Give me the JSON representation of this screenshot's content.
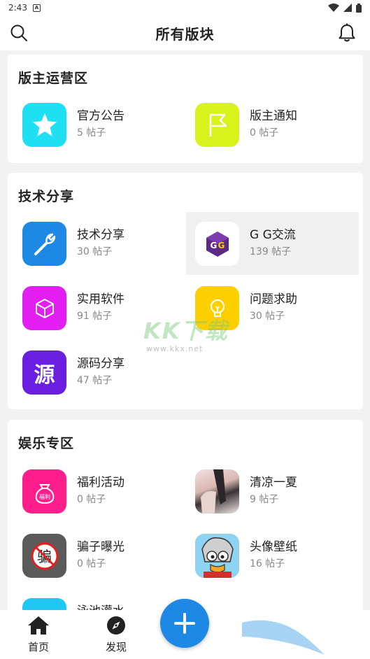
{
  "status": {
    "time": "2:43",
    "note_icon_letter": "A"
  },
  "header": {
    "title": "所有版块"
  },
  "sections": [
    {
      "title": "版主运营区",
      "items": [
        {
          "name": "官方公告",
          "count": "5 帖子",
          "icon": "star-icon",
          "color": "#1ee0f2"
        },
        {
          "name": "版主通知",
          "count": "0 帖子",
          "icon": "flag-icon",
          "color": "#d8f21c"
        }
      ]
    },
    {
      "title": "技术分享",
      "items": [
        {
          "name": "技术分享",
          "count": "30 帖子",
          "icon": "wrench-icon",
          "color": "#1e88e5"
        },
        {
          "name": "G G交流",
          "count": "139 帖子",
          "icon": "gg-logo-icon",
          "color": "#ffffff"
        },
        {
          "name": "实用软件",
          "count": "91 帖子",
          "icon": "cube-icon",
          "color": "#e21ef2"
        },
        {
          "name": "问题求助",
          "count": "30 帖子",
          "icon": "lightbulb-icon",
          "color": "#ffd000"
        },
        {
          "name": "源码分享",
          "count": "47 帖子",
          "icon": "yuan-character-icon",
          "icon_text": "源",
          "color": "#6a1fe0"
        }
      ]
    },
    {
      "title": "娱乐专区",
      "items": [
        {
          "name": "福利活动",
          "count": "0 帖子",
          "icon": "lucky-bag-icon",
          "icon_text": "福利",
          "color": "#ff1e8c"
        },
        {
          "name": "清凉一夏",
          "count": "9 帖子",
          "icon": "photo-thumbnail-icon",
          "color": "#c9a79a"
        },
        {
          "name": "骗子曝光",
          "count": "0 帖子",
          "icon": "no-scam-icon",
          "icon_text": "骗",
          "color": "#5a5a5a"
        },
        {
          "name": "头像壁纸",
          "count": "16 帖子",
          "icon": "cartoon-avatar-icon",
          "color": "#ffe08a"
        },
        {
          "name": "泳池灌水",
          "count": "",
          "icon": "pool-icon",
          "color": "#1ec8f2"
        }
      ]
    }
  ],
  "nav": {
    "home": "首页",
    "discover": "发现",
    "fab": "add-icon"
  },
  "watermark": {
    "big": "KK下载",
    "small": "www.kkx.net"
  }
}
